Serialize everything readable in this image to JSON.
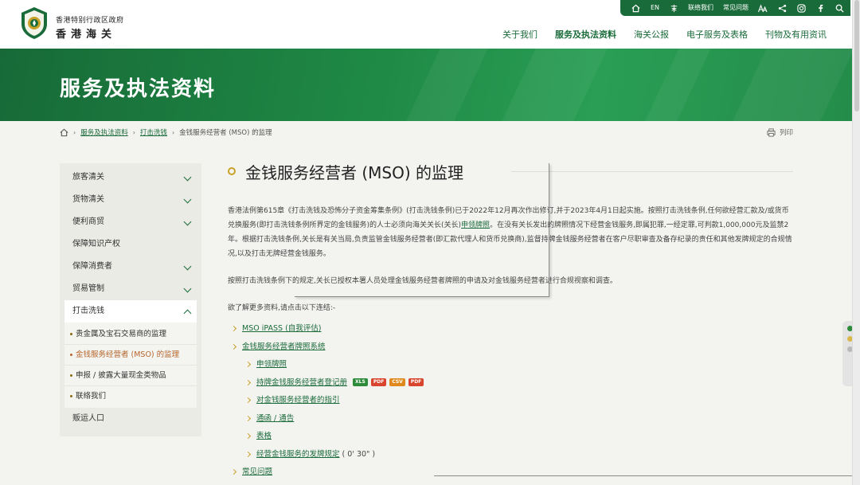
{
  "utility": {
    "lang": "EN",
    "contact": "联络我们",
    "faq": "常见问题"
  },
  "header": {
    "org_line1": "香港特别行政区政府",
    "org_line2": "香港海关",
    "nav": [
      {
        "label": "关于我们"
      },
      {
        "label": "服务及执法资料"
      },
      {
        "label": "海关公报"
      },
      {
        "label": "电子服务及表格"
      },
      {
        "label": "刊物及有用资讯"
      }
    ]
  },
  "banner": {
    "title": "服务及执法资料"
  },
  "breadcrumb": {
    "items": [
      "服务及执法资料",
      "打击洗钱"
    ],
    "current": "金钱服务经营者 (MSO) 的监理",
    "print": "列印"
  },
  "sidebar": {
    "items": [
      {
        "label": "旅客清关"
      },
      {
        "label": "货物清关"
      },
      {
        "label": "便利商贸"
      },
      {
        "label": "保障知识产权"
      },
      {
        "label": "保障消费者"
      },
      {
        "label": "贸易管制"
      },
      {
        "label": "打击洗钱"
      },
      {
        "label": "贩运人口"
      }
    ],
    "sub": [
      {
        "label": "贵金属及宝石交易商的监理"
      },
      {
        "label": "金钱服务经营者 (MSO) 的监理"
      },
      {
        "label": "申报 / 披露大量现金类物品"
      },
      {
        "label": "联络我们"
      }
    ]
  },
  "content": {
    "title": "金钱服务经营者 (MSO) 的监理",
    "para1_a": "香港法例第615章《打击洗钱及恐怖分子资金筹集条例》(打击洗钱条例)已于2022年12月再次作出修订,并于2023年4月1日起实施。按照打击洗钱条例,任何欲经营汇款及/或货币兑换服务(即打击洗钱条例所界定的金钱服务)的人士必须向海关关长(关长)",
    "para1_link": "申领牌照",
    "para1_b": "。在没有关长发出的牌照情况下经营金钱服务,即属犯罪,一经定罪,可判款1,000,000元及监禁2年。根据打击洗钱条例,关长是有关当局,负责监管金钱服务经营者(即汇款代理人和货币兑换商),监督持牌金钱服务经营者在客户尽职审查及备存纪录的责任和其他发牌规定的合规情况,以及打击无牌经营金钱服务。",
    "para2": "按照打击洗钱条例下的规定,关长已授权本署人员处理金钱服务经营者牌照的申请及对金钱服务经营者进行合规视察和调查。",
    "para3": "欲了解更多资料,请点击以下连结:-",
    "links": [
      {
        "label": "MSO iPASS (自我评估)"
      },
      {
        "label": "金钱服务经营者牌照系统"
      }
    ],
    "sublinks": [
      {
        "label": "申领牌照"
      },
      {
        "label": "持牌金钱服务经营者登记册"
      },
      {
        "label": "对金钱服务经营者的指引"
      },
      {
        "label": "通函 / 通告"
      },
      {
        "label": "表格"
      },
      {
        "label": "经营金钱服务的发牌规定"
      }
    ],
    "file_badges": [
      {
        "label": "XLS",
        "color": "#2e8b3a"
      },
      {
        "label": "PDF",
        "color": "#d9442e"
      },
      {
        "label": "CSV",
        "color": "#e08a1e"
      },
      {
        "label": "PDF",
        "color": "#d9442e"
      }
    ],
    "video_duration": "( 0' 30\" )",
    "last_link": "常见问题"
  },
  "colors": {
    "brand_green": "#1a6b3a",
    "accent_gold": "#c9a227",
    "current_orange": "#b5632a"
  }
}
